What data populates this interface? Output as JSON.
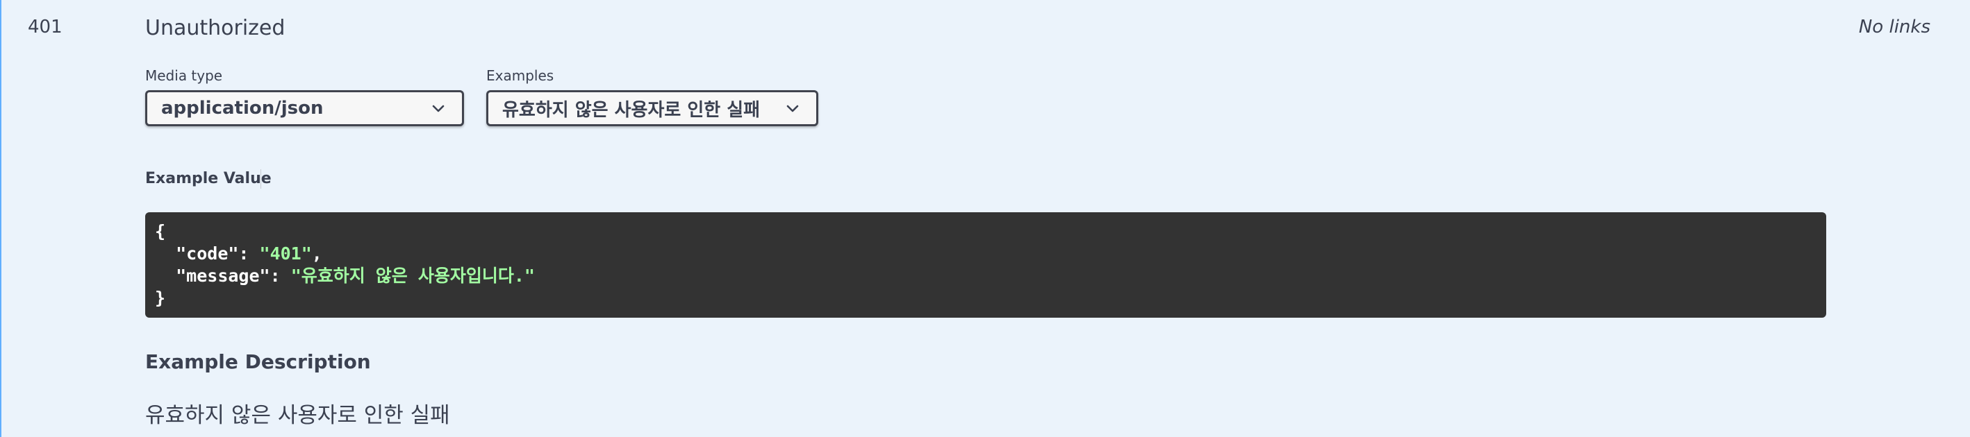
{
  "response": {
    "status_code": "401",
    "description": "Unauthorized",
    "links": "No links",
    "media_type": {
      "label": "Media type",
      "selected": "application/json"
    },
    "examples": {
      "label": "Examples",
      "selected": "유효하지 않은 사용자로 인한 실패"
    },
    "example_value": {
      "label": "Example Value",
      "open_brace": "{",
      "close_brace": "}",
      "code_key": "\"code\"",
      "code_value": "\"401\"",
      "message_key": "\"message\"",
      "message_value": "\"유효하지 않은 사용자입니다.\""
    },
    "example_description": {
      "title": "Example Description",
      "text": "유효하지 않은 사용자로 인한 실패"
    }
  },
  "colors": {
    "background": "#ebf3fb",
    "accent": "#61affe",
    "code_background": "#333333",
    "code_string": "#a2fca2"
  }
}
